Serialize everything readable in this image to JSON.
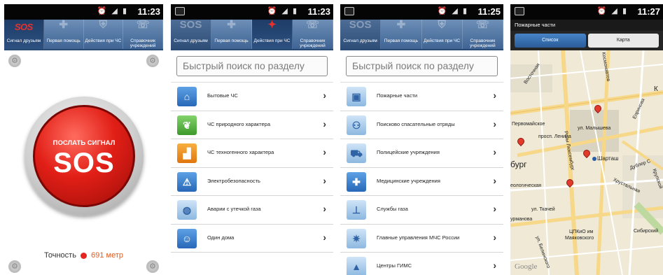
{
  "status": {
    "phone1_time": "11:23",
    "phone2_time": "11:23",
    "phone3_time": "11:25",
    "phone4_time": "11:27"
  },
  "tabs": [
    {
      "label": "Сигнал друзьям"
    },
    {
      "label": "Первая помощь"
    },
    {
      "label": "Действия при ЧС"
    },
    {
      "label": "Справочник учреждений"
    }
  ],
  "sos_screen": {
    "tab_sos_text": "SOS",
    "button_small": "ПОСЛАТЬ СИГНАЛ",
    "button_big": "SOS",
    "accuracy_label": "Точность",
    "accuracy_value": "691",
    "accuracy_unit": "метр"
  },
  "search_placeholder": "Быстрый поиск по разделу",
  "emergency_list": [
    {
      "label": "Бытовые ЧС",
      "icon": "house-icon"
    },
    {
      "label": "ЧС природного характера",
      "icon": "nature-icon"
    },
    {
      "label": "ЧС техногенного характера",
      "icon": "factory-icon"
    },
    {
      "label": "Электробезопасность",
      "icon": "electric-hazard-icon"
    },
    {
      "label": "Аварии с утечкой газа",
      "icon": "gas-icon"
    },
    {
      "label": "Один дома",
      "icon": "child-home-icon"
    }
  ],
  "directory_list": [
    {
      "label": "Пожарные части",
      "icon": "fire-truck-icon"
    },
    {
      "label": "Поисково спасательные отряды",
      "icon": "rescue-icon"
    },
    {
      "label": "Полицейские учреждения",
      "icon": "police-car-icon"
    },
    {
      "label": "Медицинские учреждения",
      "icon": "hospital-icon"
    },
    {
      "label": "Службы газа",
      "icon": "gas-service-icon"
    },
    {
      "label": "Главные управления МЧС России",
      "icon": "emercom-icon"
    },
    {
      "label": "Центры ГИМС",
      "icon": "gims-icon"
    }
  ],
  "map_screen": {
    "title": "Пожарные части",
    "tab_list": "Список",
    "tab_map": "Карта",
    "labels": {
      "pervomayskoe": "Первомайское",
      "lenina": "просп. Ленина",
      "malysheva": "ул. Малышева",
      "burg": "бург",
      "shartash": "Шарташ",
      "geologic": "еологическая",
      "tkachey": "ул. Ткачей",
      "ckpio": "ЦПКиО им",
      "mayakovskogo": "Маяковского",
      "vostochnaya": "Восточная",
      "rozy": "Розы Люксембург",
      "khrustalnaya": "Хрустальная",
      "sibirsky": "Сибирский",
      "k": "К",
      "kosmonavtov": "Космонавтов",
      "armianova": "урманова",
      "belinskogo": "ул. Белинского",
      "dublerr": "Дублер С",
      "eprinova": "Епринова",
      "krupskoy": "Крупской"
    },
    "google": "Google"
  },
  "colors": {
    "tab_bar": "#3f6494",
    "sos_red": "#e11f17",
    "accent_orange": "#e35a17",
    "map_bg": "#efe9d6"
  }
}
